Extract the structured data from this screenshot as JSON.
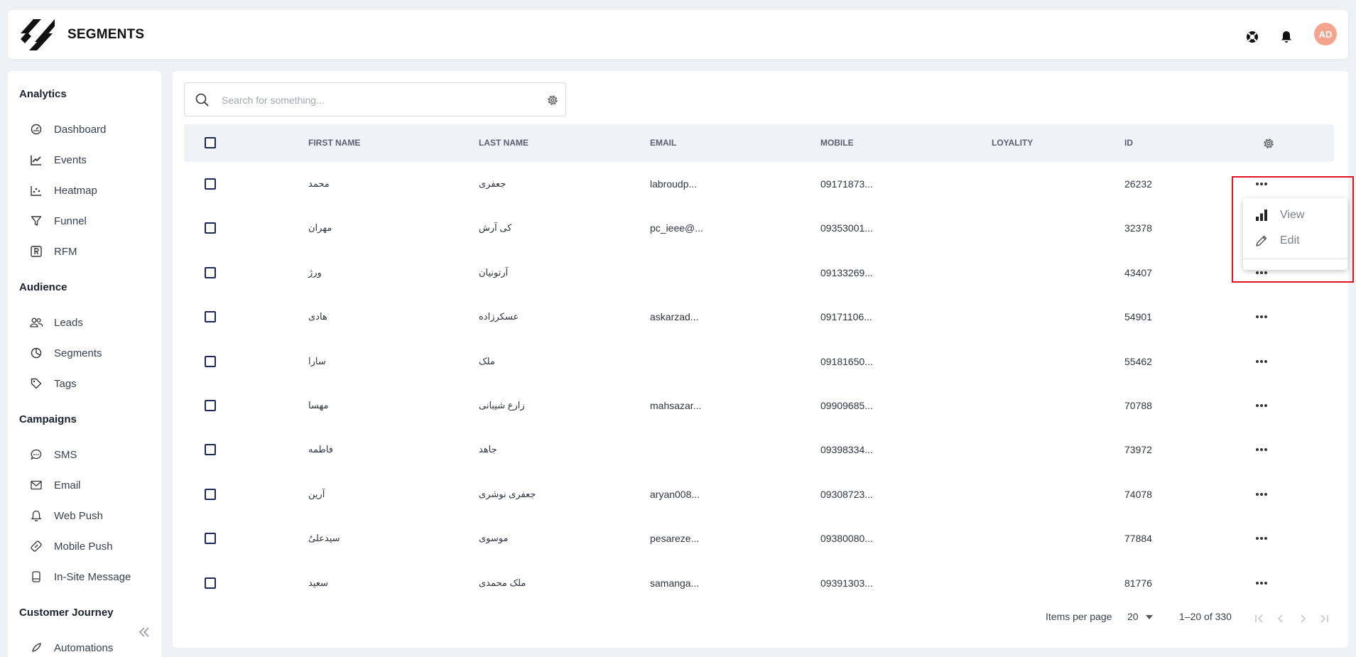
{
  "header": {
    "title": "SEGMENTS",
    "avatar_initials": "AD",
    "icons": [
      "lifebuoy-icon",
      "bell-icon"
    ]
  },
  "sidebar": {
    "sections": [
      {
        "title": "Analytics",
        "items": [
          {
            "label": "Dashboard",
            "icon": "gauge-icon"
          },
          {
            "label": "Events",
            "icon": "trend-icon"
          },
          {
            "label": "Heatmap",
            "icon": "scatter-icon"
          },
          {
            "label": "Funnel",
            "icon": "funnel-icon"
          },
          {
            "label": "RFM",
            "icon": "rfm-icon"
          }
        ]
      },
      {
        "title": "Audience",
        "items": [
          {
            "label": "Leads",
            "icon": "users-icon"
          },
          {
            "label": "Segments",
            "icon": "pie-icon"
          },
          {
            "label": "Tags",
            "icon": "tag-icon"
          }
        ]
      },
      {
        "title": "Campaigns",
        "items": [
          {
            "label": "SMS",
            "icon": "chat-icon"
          },
          {
            "label": "Email",
            "icon": "mail-icon"
          },
          {
            "label": "Web Push",
            "icon": "bell-outline-icon"
          },
          {
            "label": "Mobile Push",
            "icon": "mobile-push-icon"
          },
          {
            "label": "In-Site Message",
            "icon": "device-icon"
          }
        ]
      },
      {
        "title": "Customer Journey",
        "items": [
          {
            "label": "Automations",
            "icon": "rocket-icon"
          }
        ]
      }
    ]
  },
  "search": {
    "placeholder": "Search for something..."
  },
  "table": {
    "columns": [
      "FIRST NAME",
      "LAST NAME",
      "EMAIL",
      "MOBILE",
      "LOYALITY",
      "ID"
    ],
    "rows": [
      {
        "first": "محمد",
        "last": "جعفری",
        "email": "labroudp...",
        "mobile": "09171873...",
        "loyality": "",
        "id": "26232"
      },
      {
        "first": "مهران",
        "last": "کی آرش",
        "email": "pc_ieee@...",
        "mobile": "09353001...",
        "loyality": "",
        "id": "32378"
      },
      {
        "first": "ورژ",
        "last": "آرتونیان",
        "email": "",
        "mobile": "09133269...",
        "loyality": "",
        "id": "43407"
      },
      {
        "first": "هادی",
        "last": "عسکرزاده",
        "email": "askarzad...",
        "mobile": "09171106...",
        "loyality": "",
        "id": "54901"
      },
      {
        "first": "سارا",
        "last": "ملک",
        "email": "",
        "mobile": "09181650...",
        "loyality": "",
        "id": "55462"
      },
      {
        "first": "مهسا",
        "last": "زارع شیبانی",
        "email": "mahsazar...",
        "mobile": "09909685...",
        "loyality": "",
        "id": "70788"
      },
      {
        "first": "فاطمه",
        "last": "جاهد",
        "email": "",
        "mobile": "09398334...",
        "loyality": "",
        "id": "73972"
      },
      {
        "first": "آرین",
        "last": "جعفری نوشری",
        "email": "aryan008...",
        "mobile": "09308723...",
        "loyality": "",
        "id": "74078"
      },
      {
        "first": "سیدعلیُ",
        "last": "موسوی",
        "email": "pesareze...",
        "mobile": "09380080...",
        "loyality": "",
        "id": "77884"
      },
      {
        "first": "سعید",
        "last": "ملک محمدی",
        "email": "samanga...",
        "mobile": "09391303...",
        "loyality": "",
        "id": "81776"
      }
    ]
  },
  "row_menu": {
    "items": [
      {
        "label": "View",
        "icon": "bar-chart-icon"
      },
      {
        "label": "Edit",
        "icon": "pencil-icon"
      }
    ]
  },
  "pagination": {
    "items_per_page_label": "Items per page",
    "page_size": "20",
    "range": "1–20 of 330"
  },
  "colors": {
    "accent": "#1e2a55",
    "avatar": "#f6a48d",
    "highlight": "#e0141e",
    "header_bg": "#eff2f7"
  }
}
